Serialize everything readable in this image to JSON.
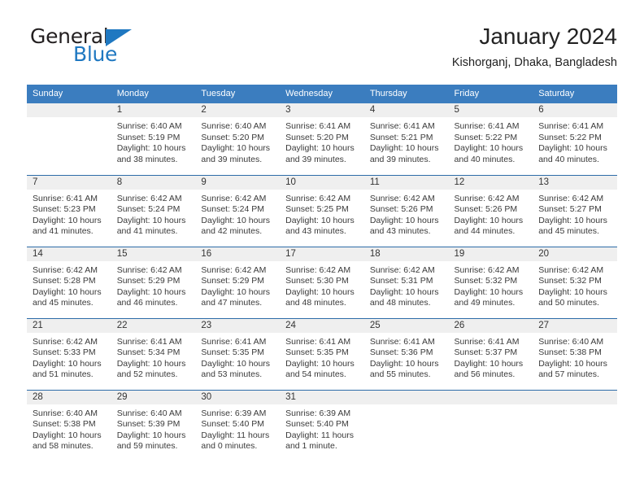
{
  "brand": {
    "line1": "General",
    "line2": "Blue",
    "triangle_icon": "triangle-icon",
    "color_dark": "#231f20",
    "color_blue": "#1f78c1"
  },
  "header": {
    "title": "January 2024",
    "subtitle": "Kishorganj, Dhaka, Bangladesh"
  },
  "theme": {
    "header_blue": "#3b7dbf",
    "row_separator": "#2d6ca8",
    "daynum_band": "#efefef",
    "text": "#3a3a3a"
  },
  "columns": [
    "Sunday",
    "Monday",
    "Tuesday",
    "Wednesday",
    "Thursday",
    "Friday",
    "Saturday"
  ],
  "weeks": [
    [
      {
        "day": "",
        "lines": []
      },
      {
        "day": "1",
        "lines": [
          "Sunrise: 6:40 AM",
          "Sunset: 5:19 PM",
          "Daylight: 10 hours",
          "and 38 minutes."
        ]
      },
      {
        "day": "2",
        "lines": [
          "Sunrise: 6:40 AM",
          "Sunset: 5:20 PM",
          "Daylight: 10 hours",
          "and 39 minutes."
        ]
      },
      {
        "day": "3",
        "lines": [
          "Sunrise: 6:41 AM",
          "Sunset: 5:20 PM",
          "Daylight: 10 hours",
          "and 39 minutes."
        ]
      },
      {
        "day": "4",
        "lines": [
          "Sunrise: 6:41 AM",
          "Sunset: 5:21 PM",
          "Daylight: 10 hours",
          "and 39 minutes."
        ]
      },
      {
        "day": "5",
        "lines": [
          "Sunrise: 6:41 AM",
          "Sunset: 5:22 PM",
          "Daylight: 10 hours",
          "and 40 minutes."
        ]
      },
      {
        "day": "6",
        "lines": [
          "Sunrise: 6:41 AM",
          "Sunset: 5:22 PM",
          "Daylight: 10 hours",
          "and 40 minutes."
        ]
      }
    ],
    [
      {
        "day": "7",
        "lines": [
          "Sunrise: 6:41 AM",
          "Sunset: 5:23 PM",
          "Daylight: 10 hours",
          "and 41 minutes."
        ]
      },
      {
        "day": "8",
        "lines": [
          "Sunrise: 6:42 AM",
          "Sunset: 5:24 PM",
          "Daylight: 10 hours",
          "and 41 minutes."
        ]
      },
      {
        "day": "9",
        "lines": [
          "Sunrise: 6:42 AM",
          "Sunset: 5:24 PM",
          "Daylight: 10 hours",
          "and 42 minutes."
        ]
      },
      {
        "day": "10",
        "lines": [
          "Sunrise: 6:42 AM",
          "Sunset: 5:25 PM",
          "Daylight: 10 hours",
          "and 43 minutes."
        ]
      },
      {
        "day": "11",
        "lines": [
          "Sunrise: 6:42 AM",
          "Sunset: 5:26 PM",
          "Daylight: 10 hours",
          "and 43 minutes."
        ]
      },
      {
        "day": "12",
        "lines": [
          "Sunrise: 6:42 AM",
          "Sunset: 5:26 PM",
          "Daylight: 10 hours",
          "and 44 minutes."
        ]
      },
      {
        "day": "13",
        "lines": [
          "Sunrise: 6:42 AM",
          "Sunset: 5:27 PM",
          "Daylight: 10 hours",
          "and 45 minutes."
        ]
      }
    ],
    [
      {
        "day": "14",
        "lines": [
          "Sunrise: 6:42 AM",
          "Sunset: 5:28 PM",
          "Daylight: 10 hours",
          "and 45 minutes."
        ]
      },
      {
        "day": "15",
        "lines": [
          "Sunrise: 6:42 AM",
          "Sunset: 5:29 PM",
          "Daylight: 10 hours",
          "and 46 minutes."
        ]
      },
      {
        "day": "16",
        "lines": [
          "Sunrise: 6:42 AM",
          "Sunset: 5:29 PM",
          "Daylight: 10 hours",
          "and 47 minutes."
        ]
      },
      {
        "day": "17",
        "lines": [
          "Sunrise: 6:42 AM",
          "Sunset: 5:30 PM",
          "Daylight: 10 hours",
          "and 48 minutes."
        ]
      },
      {
        "day": "18",
        "lines": [
          "Sunrise: 6:42 AM",
          "Sunset: 5:31 PM",
          "Daylight: 10 hours",
          "and 48 minutes."
        ]
      },
      {
        "day": "19",
        "lines": [
          "Sunrise: 6:42 AM",
          "Sunset: 5:32 PM",
          "Daylight: 10 hours",
          "and 49 minutes."
        ]
      },
      {
        "day": "20",
        "lines": [
          "Sunrise: 6:42 AM",
          "Sunset: 5:32 PM",
          "Daylight: 10 hours",
          "and 50 minutes."
        ]
      }
    ],
    [
      {
        "day": "21",
        "lines": [
          "Sunrise: 6:42 AM",
          "Sunset: 5:33 PM",
          "Daylight: 10 hours",
          "and 51 minutes."
        ]
      },
      {
        "day": "22",
        "lines": [
          "Sunrise: 6:41 AM",
          "Sunset: 5:34 PM",
          "Daylight: 10 hours",
          "and 52 minutes."
        ]
      },
      {
        "day": "23",
        "lines": [
          "Sunrise: 6:41 AM",
          "Sunset: 5:35 PM",
          "Daylight: 10 hours",
          "and 53 minutes."
        ]
      },
      {
        "day": "24",
        "lines": [
          "Sunrise: 6:41 AM",
          "Sunset: 5:35 PM",
          "Daylight: 10 hours",
          "and 54 minutes."
        ]
      },
      {
        "day": "25",
        "lines": [
          "Sunrise: 6:41 AM",
          "Sunset: 5:36 PM",
          "Daylight: 10 hours",
          "and 55 minutes."
        ]
      },
      {
        "day": "26",
        "lines": [
          "Sunrise: 6:41 AM",
          "Sunset: 5:37 PM",
          "Daylight: 10 hours",
          "and 56 minutes."
        ]
      },
      {
        "day": "27",
        "lines": [
          "Sunrise: 6:40 AM",
          "Sunset: 5:38 PM",
          "Daylight: 10 hours",
          "and 57 minutes."
        ]
      }
    ],
    [
      {
        "day": "28",
        "lines": [
          "Sunrise: 6:40 AM",
          "Sunset: 5:38 PM",
          "Daylight: 10 hours",
          "and 58 minutes."
        ]
      },
      {
        "day": "29",
        "lines": [
          "Sunrise: 6:40 AM",
          "Sunset: 5:39 PM",
          "Daylight: 10 hours",
          "and 59 minutes."
        ]
      },
      {
        "day": "30",
        "lines": [
          "Sunrise: 6:39 AM",
          "Sunset: 5:40 PM",
          "Daylight: 11 hours",
          "and 0 minutes."
        ]
      },
      {
        "day": "31",
        "lines": [
          "Sunrise: 6:39 AM",
          "Sunset: 5:40 PM",
          "Daylight: 11 hours",
          "and 1 minute."
        ]
      },
      {
        "day": "",
        "lines": []
      },
      {
        "day": "",
        "lines": []
      },
      {
        "day": "",
        "lines": []
      }
    ]
  ]
}
